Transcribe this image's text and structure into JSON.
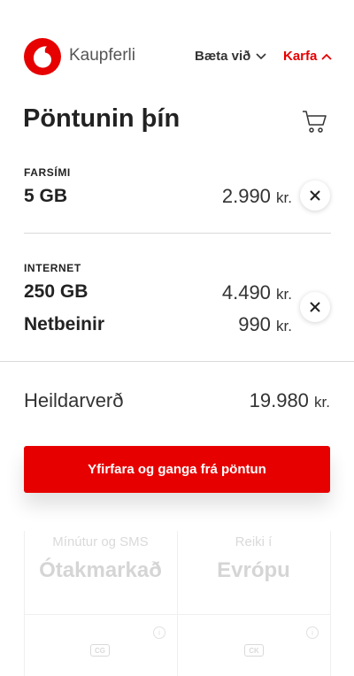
{
  "header": {
    "brand": "Kaupferli",
    "add_label": "Bæta við",
    "cart_label": "Karfa"
  },
  "order": {
    "title": "Pöntunin þín",
    "currency": "kr.",
    "sections": [
      {
        "label": "FARSÍMI",
        "items": [
          {
            "name": "5 GB",
            "price": "2.990"
          }
        ]
      },
      {
        "label": "INTERNET",
        "items": [
          {
            "name": "250 GB",
            "price": "4.490"
          },
          {
            "name": "Netbeinir",
            "price": "990"
          }
        ]
      }
    ],
    "total_label": "Heildarverð",
    "total_price": "19.980",
    "checkout_label": "Yfirfara og ganga frá pöntun"
  },
  "plans": [
    {
      "small": "Mínútur og SMS",
      "big": "Ótakmarkað",
      "chip": "CG"
    },
    {
      "small": "Reiki í",
      "big": "Evrópu",
      "chip": "CK"
    }
  ],
  "colors": {
    "accent": "#e60000",
    "text": "#222222",
    "divider": "#d9d9d9"
  }
}
